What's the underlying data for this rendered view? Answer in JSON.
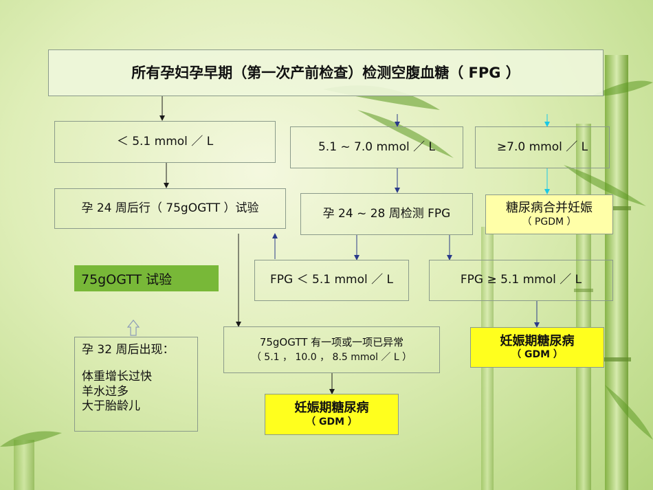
{
  "title": "所有孕妇孕早期（第一次产前检查）检测空腹血糖（ FPG ）",
  "branch_low": "＜ 5.1 mmol ／ L",
  "branch_mid": "5.1 ~ 7.0 mmol ／ L",
  "branch_high": "≥7.0 mmol ／ L",
  "ogtt_step": "孕 24 周后行（ 75gOGTT ）试验",
  "fpg_recheck": "孕 24 ~ 28 周检测 FPG",
  "pgdm": {
    "line1": "糖尿病合并妊娠",
    "line2": "（ PGDM ）"
  },
  "ogtt_label": "75gOGTT 试验",
  "fpg_lt": "FPG ＜ 5.1 mmol ／ L",
  "fpg_ge": "FPG ≥ 5.1 mmol ／ L",
  "gdm_right": {
    "line1": "妊娠期糖尿病",
    "line2": "（ GDM ）"
  },
  "ogtt_abnormal": {
    "line1": "75gOGTT 有一项或一项已异常",
    "line2": "（ 5.1 ， 10.0 ， 8.5 mmol ／ L ）"
  },
  "gdm_bottom": {
    "line1": "妊娠期糖尿病",
    "line2": "（ GDM ）"
  },
  "week32": {
    "heading": "孕 32 周后出现：",
    "items": [
      "体重增长过快",
      "羊水过多",
      "大于胎龄儿"
    ]
  },
  "colors": {
    "yellow": "#ffff1e",
    "pale_yellow": "#ffffa8",
    "green_label": "#78b838",
    "arrow_dark": "#1a1a1a",
    "arrow_blue": "#2a3a8a",
    "arrow_cyan": "#19c8e6"
  }
}
